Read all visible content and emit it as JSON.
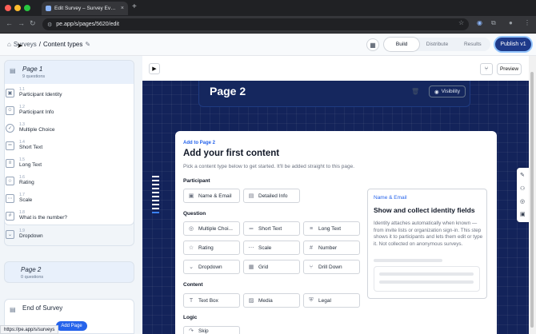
{
  "browser": {
    "tab_title": "Edit Survey – Survey Everywh",
    "tab_close": "×",
    "new_tab": "+",
    "url": "pe.app/s/pages/5620/edit",
    "status_url": "https://pe.app/s/surveys"
  },
  "header": {
    "breadcrumb_root": "Surveys",
    "breadcrumb_sep": "/",
    "breadcrumb_current": "Content types",
    "tabs": [
      {
        "label": "Build"
      },
      {
        "label": "Distribute"
      },
      {
        "label": "Results"
      }
    ],
    "publish_label": "Publish v1"
  },
  "sidebar": {
    "page1": {
      "title": "Page 1",
      "subtitle": "9 questions"
    },
    "items": [
      {
        "num": "1.1",
        "label": "Participant Identity",
        "icon": "id-card-icon"
      },
      {
        "num": "1.2",
        "label": "Participant Info",
        "icon": "person-icon"
      },
      {
        "num": "1.3",
        "label": "Multiple Choice",
        "icon": "check-circle-icon"
      },
      {
        "num": "1.4",
        "label": "Short Text",
        "icon": "short-text-icon"
      },
      {
        "num": "1.5",
        "label": "Long Text",
        "icon": "long-text-icon"
      },
      {
        "num": "1.6",
        "label": "Rating",
        "icon": "star-icon"
      },
      {
        "num": "1.7",
        "label": "Scale",
        "icon": "scale-icon"
      },
      {
        "num": "1.8",
        "label": "What is the number?",
        "icon": "hash-icon"
      },
      {
        "num": "1.9",
        "label": "Dropdown",
        "icon": "chevron-down-icon"
      }
    ],
    "page2": {
      "title": "Page 2",
      "subtitle": "0 questions"
    },
    "end": {
      "title": "End of Survey"
    },
    "add_page_label": "Add Page"
  },
  "canvas": {
    "preview_label": "Preview",
    "page_title": "Page 2",
    "visibility_label": "Visibility"
  },
  "panel": {
    "add_to": "Add to Page 2",
    "heading": "Add your first content",
    "instructions": "Pick a content type below to get started. It'll be added straight to this page.",
    "sections": {
      "participant": {
        "title": "Participant",
        "buttons": [
          {
            "label": "Name & Email",
            "icon": "id-card-icon"
          },
          {
            "label": "Detailed Info",
            "icon": "person-card-icon"
          }
        ]
      },
      "question": {
        "title": "Question",
        "buttons": [
          {
            "label": "Multiple Choi...",
            "icon": "check-circle-icon"
          },
          {
            "label": "Short Text",
            "icon": "short-text-icon"
          },
          {
            "label": "Long Text",
            "icon": "long-text-icon"
          },
          {
            "label": "Rating",
            "icon": "star-icon"
          },
          {
            "label": "Scale",
            "icon": "scale-icon"
          },
          {
            "label": "Number",
            "icon": "hash-icon"
          },
          {
            "label": "Dropdown",
            "icon": "chevron-down-icon"
          },
          {
            "label": "Grid",
            "icon": "grid-icon"
          },
          {
            "label": "Drill Down",
            "icon": "drill-down-icon"
          }
        ]
      },
      "content": {
        "title": "Content",
        "buttons": [
          {
            "label": "Text Box",
            "icon": "text-box-icon"
          },
          {
            "label": "Media",
            "icon": "media-icon"
          },
          {
            "label": "Legal",
            "icon": "shield-icon"
          }
        ]
      },
      "logic": {
        "title": "Logic",
        "buttons": [
          {
            "label": "Skip",
            "icon": "skip-icon"
          }
        ]
      }
    },
    "info": {
      "tag": "Name & Email",
      "title": "Show and collect identity fields",
      "body": "Identity attaches automatically when known — from invite lists or organization sign-in. This step shows it to participants and lets them edit or type it. Not collected on anonymous surveys."
    }
  }
}
